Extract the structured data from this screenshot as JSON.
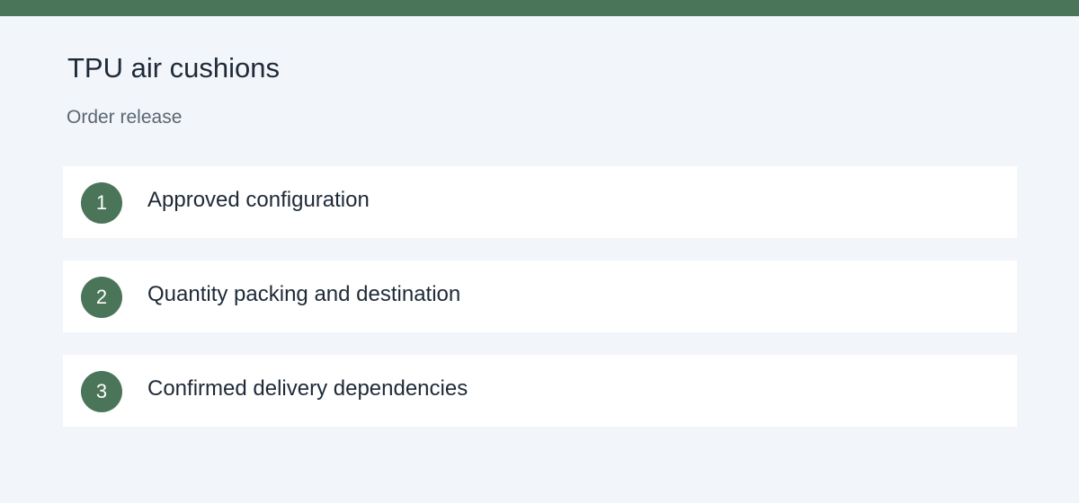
{
  "header": {
    "title": "TPU air cushions",
    "subtitle": "Order release"
  },
  "steps": [
    {
      "number": "1",
      "label": "Approved configuration"
    },
    {
      "number": "2",
      "label": "Quantity packing and destination"
    },
    {
      "number": "3",
      "label": "Confirmed delivery dependencies"
    }
  ],
  "colors": {
    "accent": "#4a7558",
    "background": "#f2f5f9",
    "card": "#ffffff",
    "text": "#1e2a38"
  }
}
